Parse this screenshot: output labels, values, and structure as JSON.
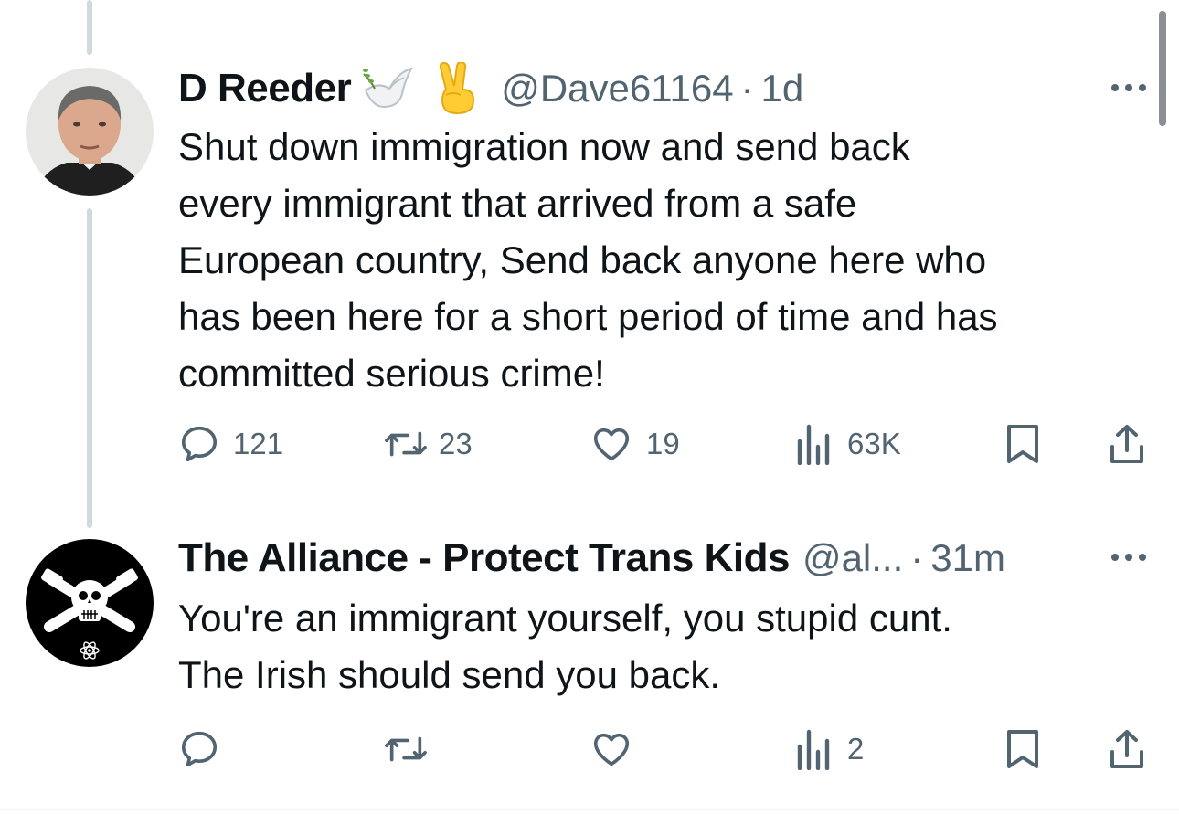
{
  "tweets": [
    {
      "author_name": "D Reeder",
      "emojis": [
        "dove-with-olive-branch-icon",
        "victory-hand-icon"
      ],
      "handle": "@Dave61164",
      "separator": "·",
      "time": "1d",
      "text": "Shut down immigration now and send back\nevery immigrant that arrived from a safe\nEuropean country, Send back anyone here who\nhas been here for a short period of time and has\ncommitted serious crime!",
      "actions": {
        "replies": "121",
        "retweets": "23",
        "likes": "19",
        "views": "63K"
      }
    },
    {
      "author_name": "The Alliance - Protect Trans Kids",
      "handle": "@al...",
      "separator": "·",
      "time": "31m",
      "text": "You're an immigrant yourself, you stupid cunt.\nThe Irish should send you back.",
      "actions": {
        "replies": "",
        "retweets": "",
        "likes": "",
        "views": "2"
      }
    }
  ],
  "colors": {
    "text": "#0f1419",
    "secondary": "#536471",
    "thread_line": "#cfd9de"
  }
}
